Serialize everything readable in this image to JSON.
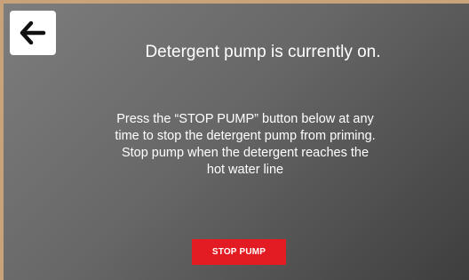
{
  "header": {
    "back_icon": "arrow-left-icon",
    "title": "Detergent pump is currently on."
  },
  "main": {
    "instructions": [
      "Press the “STOP PUMP” button below at any",
      "time to stop the detergent pump from priming.",
      "Stop pump when the detergent reaches the",
      "hot water line"
    ],
    "stop_button_label": "STOP PUMP"
  },
  "colors": {
    "stop_button": "#e31b23",
    "frame": "#c9a27a",
    "background_top": "#7d7d7d",
    "background_bottom": "#3e3e3e"
  }
}
